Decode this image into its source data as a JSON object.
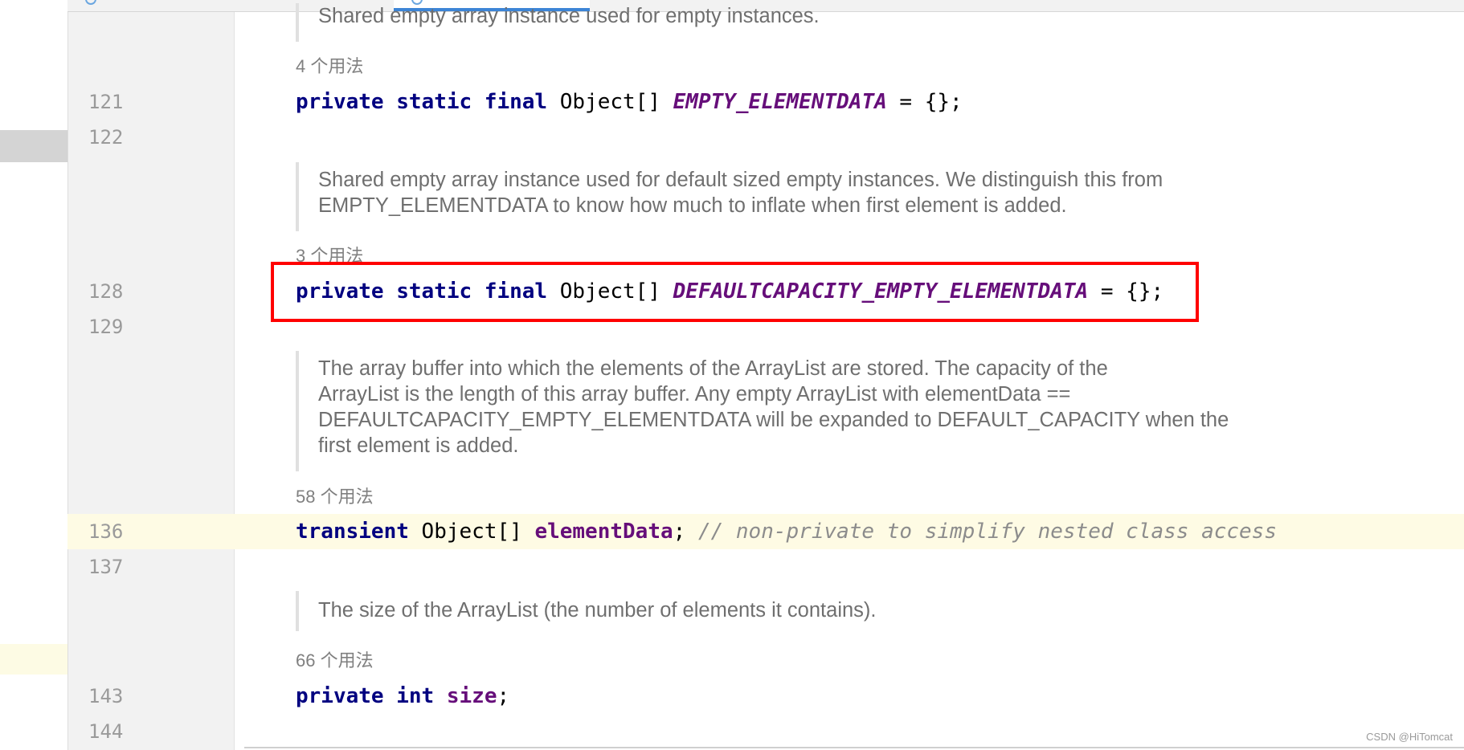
{
  "editor": {
    "lines": [
      {
        "number": "121"
      },
      {
        "number": "122"
      },
      {
        "number": "128"
      },
      {
        "number": "129"
      },
      {
        "number": "136"
      },
      {
        "number": "137"
      },
      {
        "number": "143"
      },
      {
        "number": "144"
      }
    ],
    "docs": {
      "top_partial": "Shared empty array instance used for empty instances.",
      "d1_line1": "Shared empty array instance used for default sized empty instances. We distinguish this from",
      "d1_line2": "EMPTY_ELEMENTDATA to know how much to inflate when first element is added.",
      "d2_line1": "The array buffer into which the elements of the ArrayList are stored. The capacity of the",
      "d2_line2": "ArrayList is the length of this array buffer. Any empty ArrayList with elementData ==",
      "d2_line3": "DEFAULTCAPACITY_EMPTY_ELEMENTDATA will be expanded to DEFAULT_CAPACITY when the",
      "d2_line4": "first element is added.",
      "d3_line1": "The size of the ArrayList (the number of elements it contains)."
    },
    "usages": {
      "u1": "4 个用法",
      "u2": "3 个用法",
      "u3": "58 个用法",
      "u4": "66 个用法"
    },
    "code": {
      "l121": {
        "kw1": "private",
        "kw2": "static",
        "kw3": "final",
        "type": "Object[]",
        "field": "EMPTY_ELEMENTDATA",
        "rest": "= {};"
      },
      "l128": {
        "kw1": "private",
        "kw2": "static",
        "kw3": "final",
        "type": "Object[]",
        "field": "DEFAULTCAPACITY_EMPTY_ELEMENTDATA",
        "rest": "= {};"
      },
      "l136": {
        "kw1": "transient",
        "type": "Object[]",
        "field": "elementData",
        "semi": ";",
        "comment": "// non-private to simplify nested class access"
      },
      "l143": {
        "kw1": "private",
        "kw2": "int",
        "field": "size",
        "semi": ";"
      }
    }
  },
  "watermark": "CSDN @HiTomcat",
  "colors": {
    "keyword": "#000080",
    "field": "#660e7a",
    "comment": "#8c8c8c",
    "highlight_box": "#ff0000",
    "current_line": "#fefbe4"
  }
}
